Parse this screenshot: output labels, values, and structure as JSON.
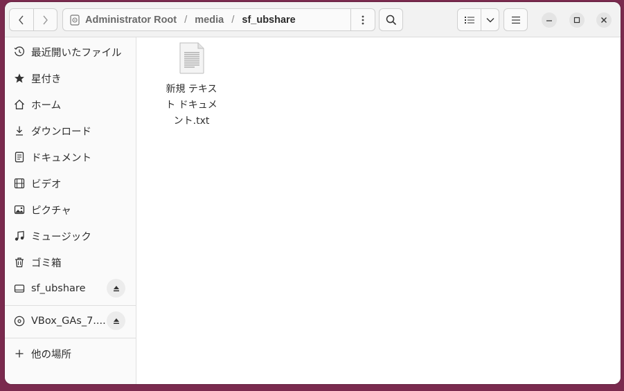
{
  "header": {
    "back_icon": "chevron-left-icon",
    "forward_icon": "chevron-right-icon",
    "location_icon": "disk-icon",
    "breadcrumbs": [
      "Administrator Root",
      "media",
      "sf_ubshare"
    ],
    "path_menu_icon": "vertical-dots-icon",
    "search_icon": "search-icon",
    "view_icon": "list-view-icon",
    "view_dropdown_icon": "chevron-down-icon",
    "menu_icon": "hamburger-icon"
  },
  "window_controls": [
    "minimize-icon",
    "maximize-icon",
    "close-icon"
  ],
  "sidebar": {
    "items": [
      {
        "label": "最近開いたファイル",
        "icon": "clock-icon"
      },
      {
        "label": "星付き",
        "icon": "star-icon"
      },
      {
        "label": "ホーム",
        "icon": "home-icon"
      },
      {
        "label": "ダウンロード",
        "icon": "download-icon"
      },
      {
        "label": "ドキュメント",
        "icon": "document-icon"
      },
      {
        "label": "ビデオ",
        "icon": "film-icon"
      },
      {
        "label": "ピクチャ",
        "icon": "picture-icon"
      },
      {
        "label": "ミュージック",
        "icon": "music-icon"
      },
      {
        "label": "ゴミ箱",
        "icon": "trash-icon"
      }
    ],
    "mounts": [
      {
        "label": "sf_ubshare",
        "icon": "drive-icon",
        "action_icon": "eject-icon"
      },
      {
        "label": "VBox_GAs_7....",
        "icon": "optical-disc-icon",
        "action_icon": "eject-icon"
      }
    ],
    "other": {
      "label": "他の場所",
      "icon": "plus-icon"
    }
  },
  "files": [
    {
      "name_lines": [
        "新規 テキス",
        "ト ドキュメ",
        "ント.txt"
      ],
      "icon": "text-file-icon"
    }
  ],
  "colors": {
    "desktop": "#7a2a4e",
    "header": "#f2f2f2",
    "sidebar": "#fafafa"
  }
}
